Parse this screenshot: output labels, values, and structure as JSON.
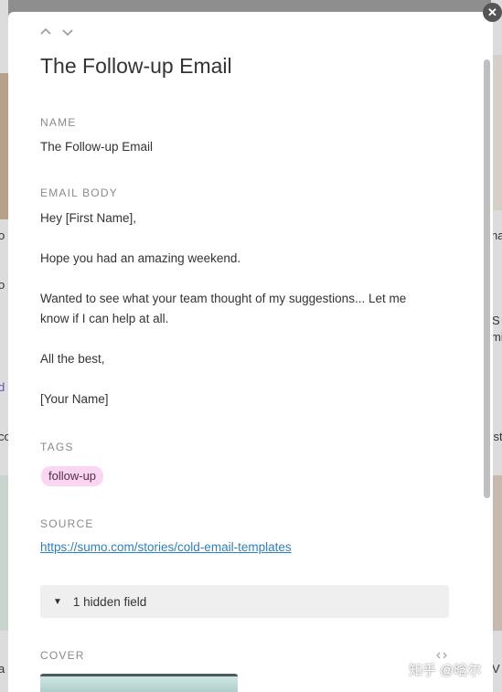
{
  "record": {
    "title": "The Follow-up Email",
    "name_label": "NAME",
    "name_value": "The Follow-up Email",
    "body_label": "EMAIL BODY",
    "body_lines": [
      "Hey [First Name],",
      "Hope you had an amazing weekend.",
      "Wanted to see what your team thought of my suggestions... Let me",
      "know if I can help at all.",
      "All the best,",
      "[Your Name]"
    ],
    "tags_label": "TAGS",
    "tags": [
      "follow-up"
    ],
    "source_label": "SOURCE",
    "source_url": "https://sumo.com/stories/cold-email-templates",
    "hidden_field_label": "1 hidden field",
    "cover_label": "COVER"
  },
  "controls": {
    "close_glyph": "✕",
    "prev_icon": "chevron-up-icon",
    "next_icon": "chevron-down-icon",
    "hidden_field_icon": "triangle-down-icon"
  },
  "background_fragments": {
    "left": [
      "o",
      "o",
      "d",
      "co",
      "a"
    ],
    "right": [
      "na",
      "S",
      "mi",
      "'st",
      "V"
    ]
  },
  "watermark": "知乎 @晗尔",
  "colors": {
    "tag_bg": "#fbd6f2",
    "link": "#2d7fc1",
    "label": "#8a8a8a"
  }
}
